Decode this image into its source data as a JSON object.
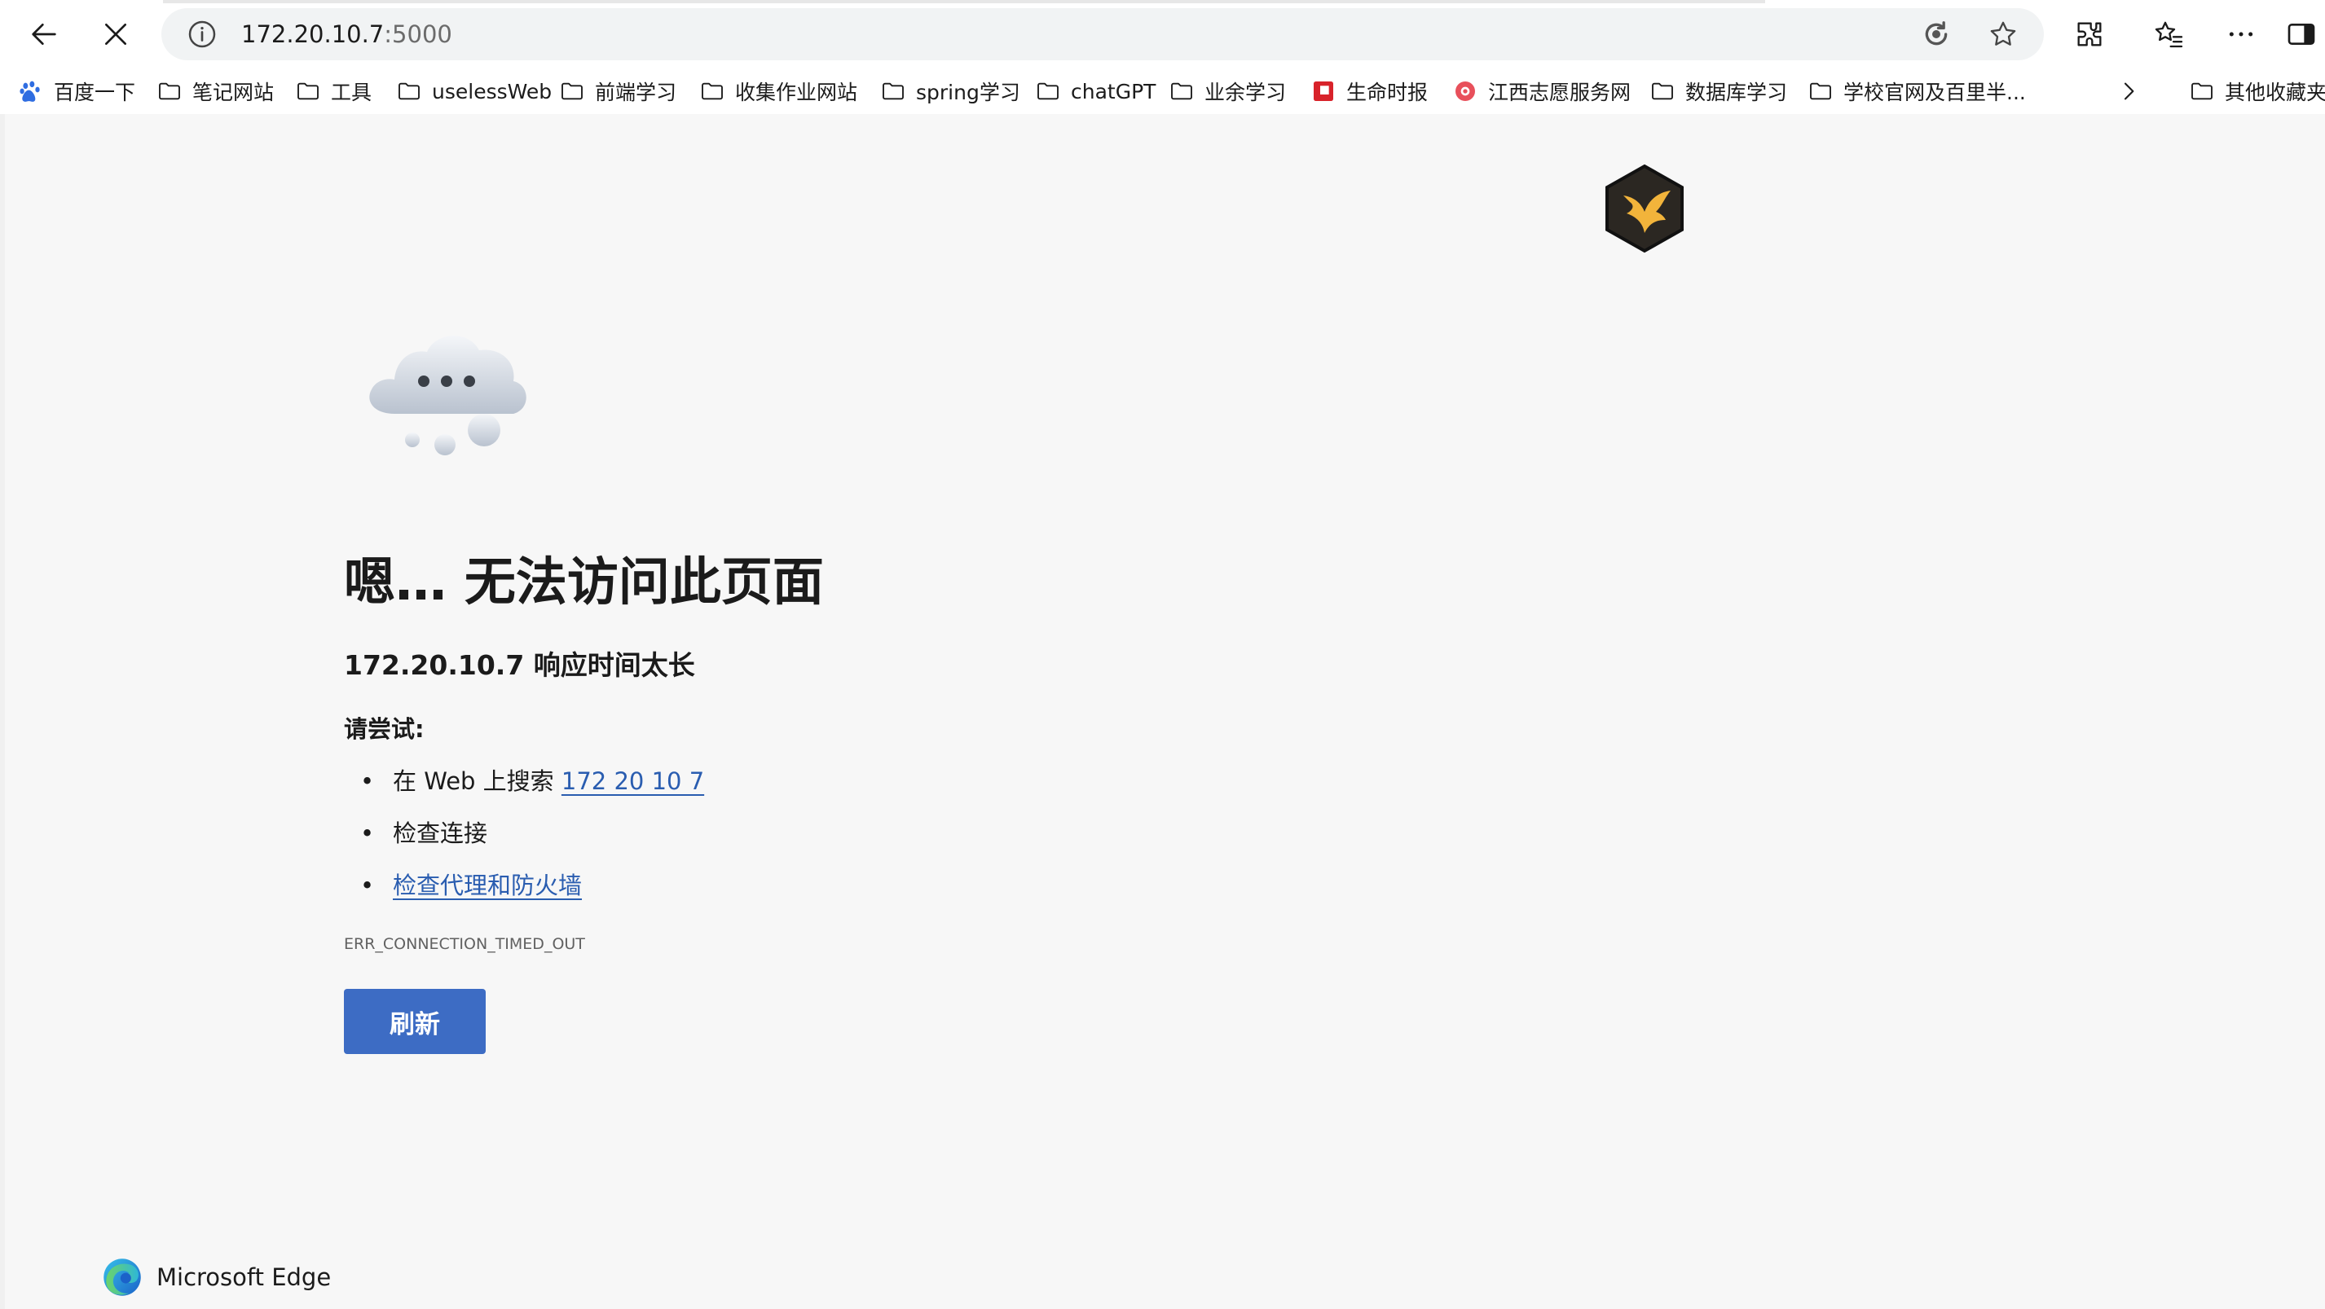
{
  "toolbar": {
    "back_icon": "arrow-left-icon",
    "stop_icon": "close-icon",
    "address": {
      "host": "172.20.10.7",
      "port": ":5000"
    },
    "icons": [
      "info-icon",
      "edge-refresh-icon",
      "star-icon",
      "extensions-icon",
      "favorites-icon",
      "more-icon",
      "sidebar-icon"
    ]
  },
  "bookmarks": {
    "items": [
      {
        "label": "百度一下",
        "icon": "baidu-icon"
      },
      {
        "label": "笔记网站",
        "icon": "folder-icon"
      },
      {
        "label": "工具",
        "icon": "folder-icon"
      },
      {
        "label": "uselessWeb",
        "icon": "folder-icon"
      },
      {
        "label": "前端学习",
        "icon": "folder-icon"
      },
      {
        "label": "收集作业网站",
        "icon": "folder-icon"
      },
      {
        "label": "spring学习",
        "icon": "folder-icon"
      },
      {
        "label": "chatGPT",
        "icon": "folder-icon"
      },
      {
        "label": "业余学习",
        "icon": "folder-icon"
      },
      {
        "label": "生命时报",
        "icon": "red-square-icon"
      },
      {
        "label": "江西志愿服务网",
        "icon": "red-circle-icon"
      },
      {
        "label": "数据库学习",
        "icon": "folder-icon"
      },
      {
        "label": "学校官网及百里半...",
        "icon": "folder-icon"
      }
    ],
    "overflow_icon": "chevron-right-icon",
    "other": "其他收藏夹"
  },
  "error": {
    "title": "嗯… 无法访问此页面",
    "subtitle": "172.20.10.7 响应时间太长",
    "try_label": "请尝试:",
    "tip1_prefix": "在 Web 上搜索 ",
    "tip1_link": "172 20 10 7",
    "tip2": "检查连接",
    "tip3_link": "检查代理和防火墙",
    "code": "ERR_CONNECTION_TIMED_OUT",
    "refresh_label": "刷新"
  },
  "brand": {
    "name": "Microsoft Edge"
  },
  "colors": {
    "link": "#2a5db0",
    "button": "#3d6cc4",
    "page_bg": "#f7f7f7"
  }
}
